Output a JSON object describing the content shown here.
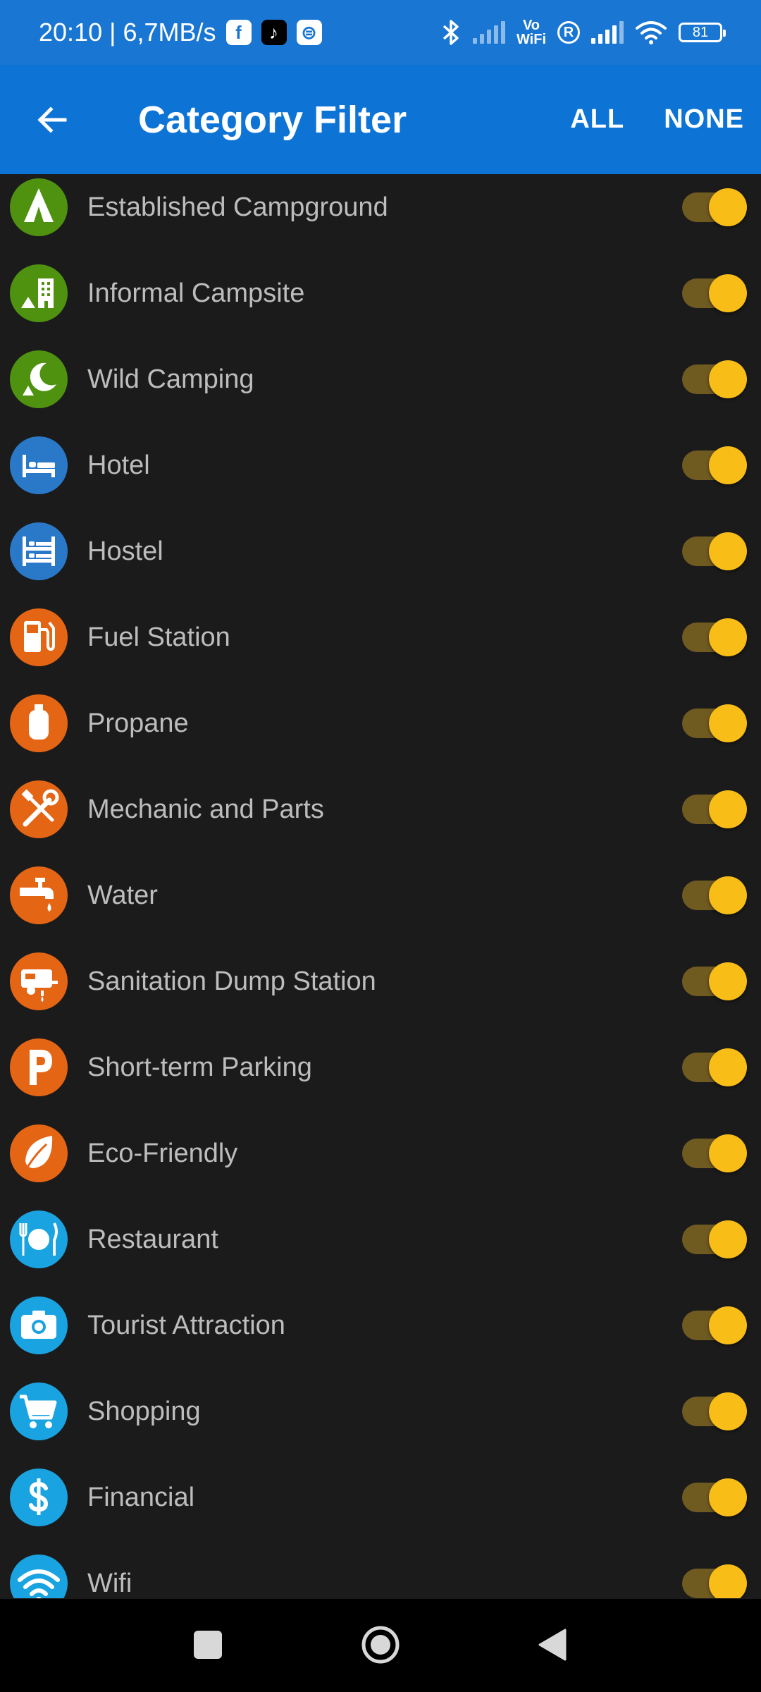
{
  "status_bar": {
    "time_speed": "20:10 | 6,7MB/s",
    "apps": [
      {
        "name": "facebook-icon",
        "glyph": "f"
      },
      {
        "name": "tiktok-icon",
        "glyph": "♪"
      },
      {
        "name": "app-icon",
        "glyph": "⊜"
      }
    ],
    "vowifi_top": "Vo",
    "vowifi_bottom": "WiFi",
    "registered": "R",
    "battery": "81"
  },
  "app_bar": {
    "title": "Category Filter",
    "all_label": "ALL",
    "none_label": "NONE"
  },
  "colors": {
    "camp_green": "#4e9210",
    "lodging_blue": "#2a79c9",
    "service_orange": "#e46514",
    "amenity_cyan": "#1aa3e1",
    "toggle_thumb": "#f9bd18",
    "toggle_track": "#6f5a20"
  },
  "categories": [
    {
      "label": "Established Campground",
      "icon": "tent-icon",
      "color": "#4e9210",
      "enabled": true
    },
    {
      "label": "Informal Campsite",
      "icon": "building-tent-icon",
      "color": "#4e9210",
      "enabled": true
    },
    {
      "label": "Wild Camping",
      "icon": "moon-tent-icon",
      "color": "#4e9210",
      "enabled": true
    },
    {
      "label": "Hotel",
      "icon": "bed-icon",
      "color": "#2a79c9",
      "enabled": true
    },
    {
      "label": "Hostel",
      "icon": "bunk-bed-icon",
      "color": "#2a79c9",
      "enabled": true
    },
    {
      "label": "Fuel Station",
      "icon": "fuel-pump-icon",
      "color": "#e46514",
      "enabled": true
    },
    {
      "label": "Propane",
      "icon": "gas-cylinder-icon",
      "color": "#e46514",
      "enabled": true
    },
    {
      "label": "Mechanic and Parts",
      "icon": "tools-icon",
      "color": "#e46514",
      "enabled": true
    },
    {
      "label": "Water",
      "icon": "water-tap-icon",
      "color": "#e46514",
      "enabled": true
    },
    {
      "label": "Sanitation Dump Station",
      "icon": "rv-dump-icon",
      "color": "#e46514",
      "enabled": true
    },
    {
      "label": "Short-term Parking",
      "icon": "parking-icon",
      "color": "#e46514",
      "enabled": true
    },
    {
      "label": "Eco-Friendly",
      "icon": "leaf-icon",
      "color": "#e46514",
      "enabled": true
    },
    {
      "label": "Restaurant",
      "icon": "restaurant-icon",
      "color": "#1aa3e1",
      "enabled": true
    },
    {
      "label": "Tourist Attraction",
      "icon": "camera-icon",
      "color": "#1aa3e1",
      "enabled": true
    },
    {
      "label": "Shopping",
      "icon": "cart-icon",
      "color": "#1aa3e1",
      "enabled": true
    },
    {
      "label": "Financial",
      "icon": "dollar-icon",
      "color": "#1aa3e1",
      "enabled": true
    },
    {
      "label": "Wifi",
      "icon": "wifi-icon",
      "color": "#1aa3e1",
      "enabled": true
    }
  ]
}
